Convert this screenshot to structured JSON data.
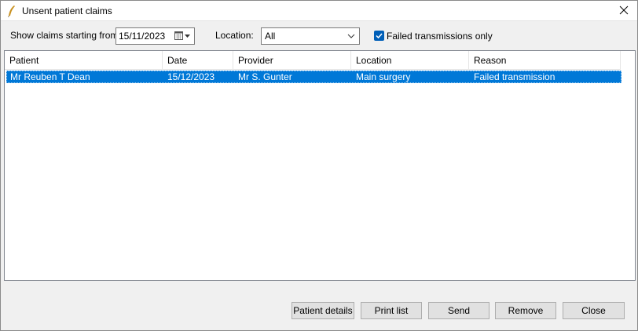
{
  "window": {
    "title": "Unsent patient claims",
    "icon": "quill-icon"
  },
  "filters": {
    "start_label": "Show claims starting from:",
    "start_date": "15/11/2023",
    "location_label": "Location:",
    "location_value": "All",
    "failed_only_label": "Failed transmissions only",
    "failed_only_checked": true
  },
  "table": {
    "columns": [
      "Patient",
      "Date",
      "Provider",
      "Location",
      "Reason"
    ],
    "rows": [
      {
        "patient": "Mr Reuben T Dean",
        "date": "15/12/2023",
        "provider": "Mr S. Gunter",
        "location": "Main surgery",
        "reason": "Failed transmission",
        "selected": true
      }
    ]
  },
  "buttons": {
    "patient_details": "Patient details",
    "print_list": "Print list",
    "send": "Send",
    "remove": "Remove",
    "close": "Close"
  },
  "colors": {
    "selection": "#0078d7",
    "checkbox": "#005fb8"
  }
}
